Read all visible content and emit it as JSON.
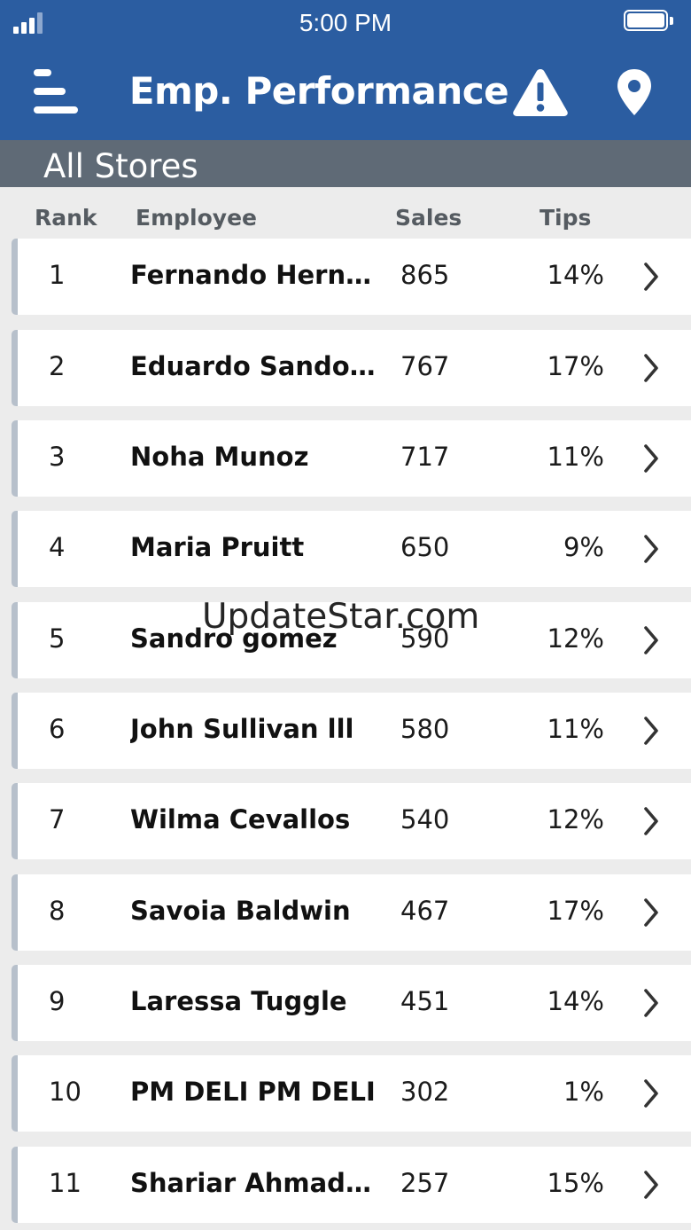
{
  "status_bar": {
    "time": "5:00 PM"
  },
  "nav": {
    "title": "Emp. Performance",
    "menu_icon": "menu-icon",
    "alert_icon": "alert-triangle-icon",
    "location_icon": "location-pin-icon"
  },
  "subheader": {
    "title": "All Stores"
  },
  "columns": {
    "rank": "Rank",
    "employee": "Employee",
    "sales": "Sales",
    "tips": "Tips"
  },
  "rows": [
    {
      "rank": "1",
      "name": "Fernando Hernan...",
      "sales": "865",
      "tips": "14%"
    },
    {
      "rank": "2",
      "name": "Eduardo Sandoval",
      "sales": "767",
      "tips": "17%"
    },
    {
      "rank": "3",
      "name": "Noha Munoz",
      "sales": "717",
      "tips": "11%"
    },
    {
      "rank": "4",
      "name": "Maria Pruitt",
      "sales": "650",
      "tips": "9%"
    },
    {
      "rank": "5",
      "name": "Sandro gomez",
      "sales": "590",
      "tips": "12%"
    },
    {
      "rank": "6",
      "name": "John Sullivan lll",
      "sales": "580",
      "tips": "11%"
    },
    {
      "rank": "7",
      "name": "Wilma Cevallos",
      "sales": "540",
      "tips": "12%"
    },
    {
      "rank": "8",
      "name": "Savoia Baldwin",
      "sales": "467",
      "tips": "17%"
    },
    {
      "rank": "9",
      "name": "Laressa Tuggle",
      "sales": "451",
      "tips": "14%"
    },
    {
      "rank": "10",
      "name": "PM DELI PM DELI",
      "sales": "302",
      "tips": "1%"
    },
    {
      "rank": "11",
      "name": "Shariar Ahmadpour",
      "sales": "257",
      "tips": "15%"
    }
  ],
  "watermark": "UpdateStar.com",
  "colors": {
    "header_blue": "#2b5da1",
    "subheader_gray": "#5f6a76",
    "row_bg": "#ffffff",
    "list_bg": "#ececec",
    "row_accent": "#b7c0cb"
  }
}
